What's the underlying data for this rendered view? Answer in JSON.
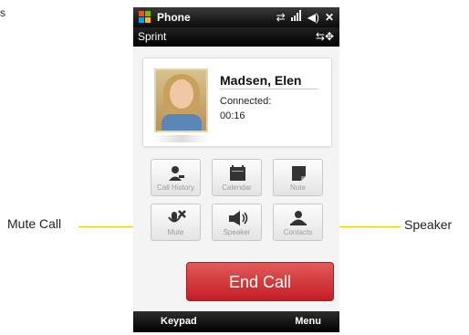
{
  "corner_text": "s",
  "titlebar": {
    "app_title": "Phone",
    "icons": [
      "windows-logo-icon",
      "sync-icon",
      "signal-icon",
      "volume-icon",
      "close-icon"
    ]
  },
  "carrierbar": {
    "carrier": "Sprint",
    "icons": [
      "connectivity-icon"
    ]
  },
  "contact": {
    "name": "Madsen, Elen",
    "status": "Connected:",
    "duration": "00:16"
  },
  "function_buttons": [
    {
      "label": "Call History",
      "icon": "call-history-icon"
    },
    {
      "label": "Calendar",
      "icon": "calendar-icon"
    },
    {
      "label": "Note",
      "icon": "note-icon"
    },
    {
      "label": "Mute",
      "icon": "mute-icon"
    },
    {
      "label": "Speaker",
      "icon": "speaker-icon"
    },
    {
      "label": "Contacts",
      "icon": "contacts-icon"
    }
  ],
  "end_call_label": "End Call",
  "softkeys": {
    "left": "Keypad",
    "right": "Menu"
  },
  "callouts": {
    "mute": "Mute Call",
    "speaker": "Speaker"
  },
  "colors": {
    "end_call": "#c21e24",
    "callout_line": "#f2c400"
  }
}
